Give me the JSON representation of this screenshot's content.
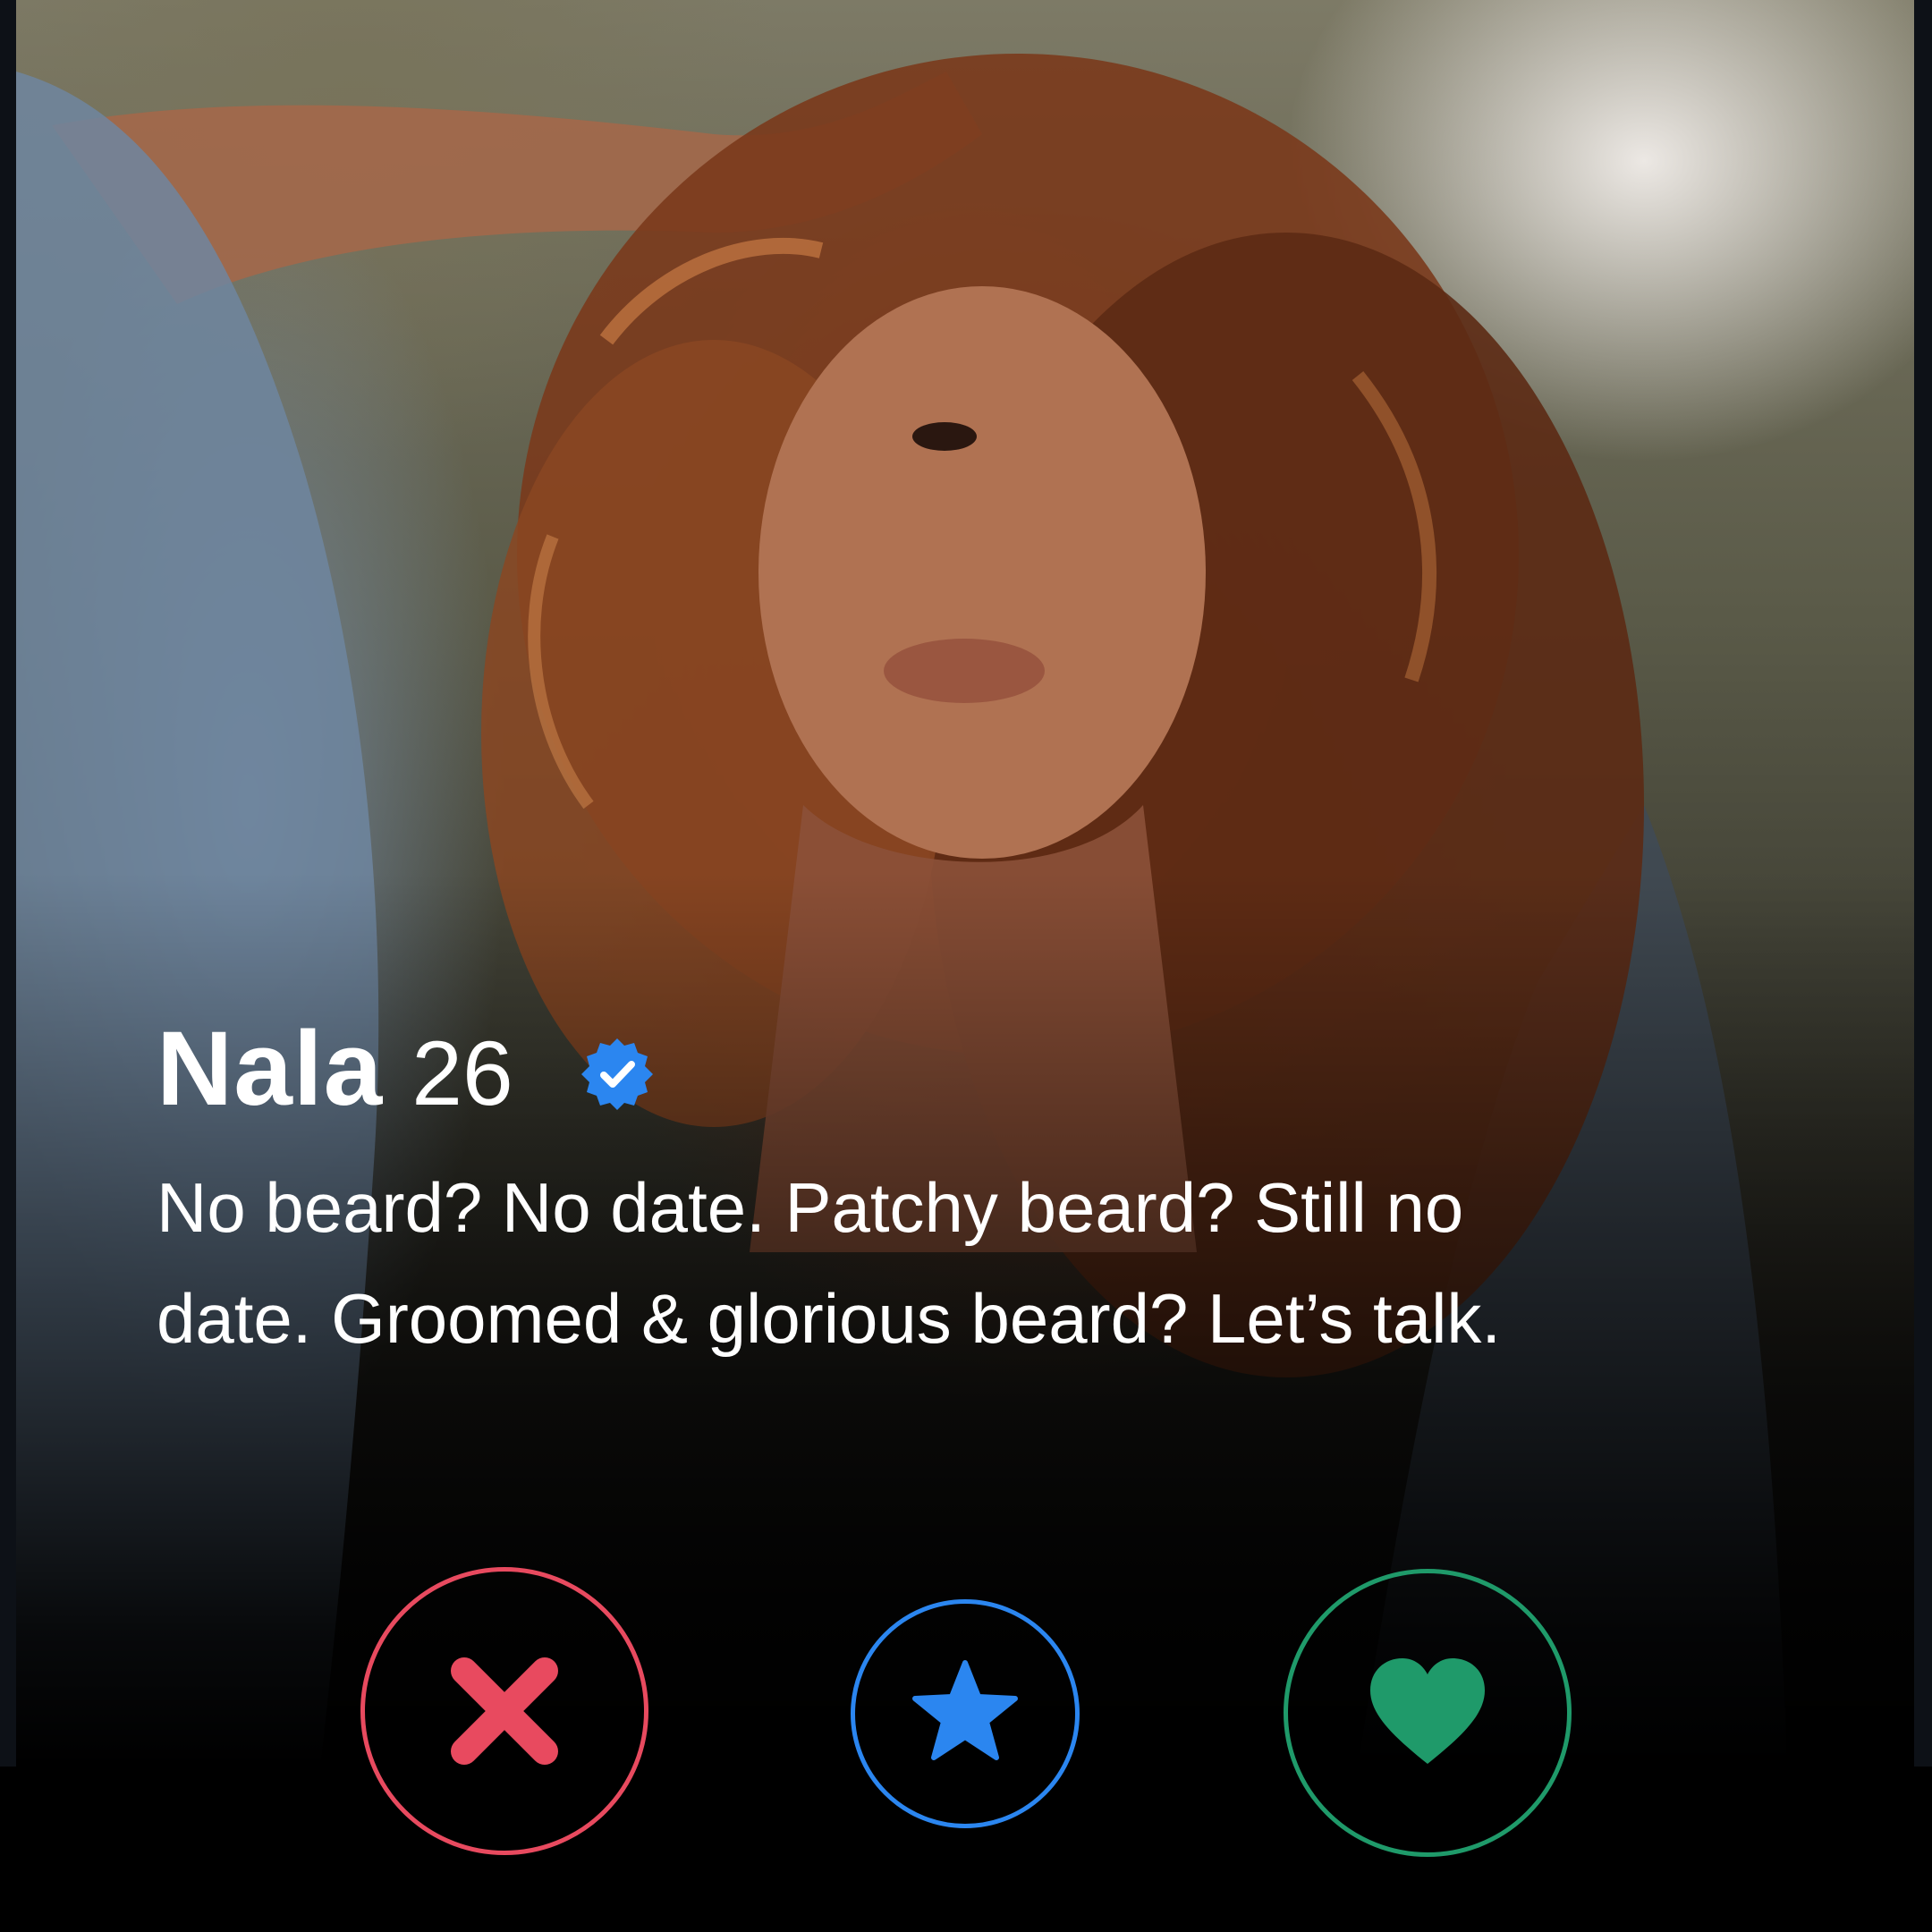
{
  "profile": {
    "name": "Nala",
    "age": "26",
    "verified": true,
    "bio": "No beard? No date. Patchy beard? Still no date. Groomed & glorious beard? Let’s talk."
  },
  "icons": {
    "verified": "verified-badge-icon",
    "nope": "close-x-icon",
    "super_like": "star-icon",
    "like": "heart-icon"
  },
  "colors": {
    "verified": "#2b86f0",
    "nope": "#e84a5f",
    "super_like": "#2b86f0",
    "like": "#1f9a6a",
    "background": "#000000",
    "text": "#ffffff"
  }
}
